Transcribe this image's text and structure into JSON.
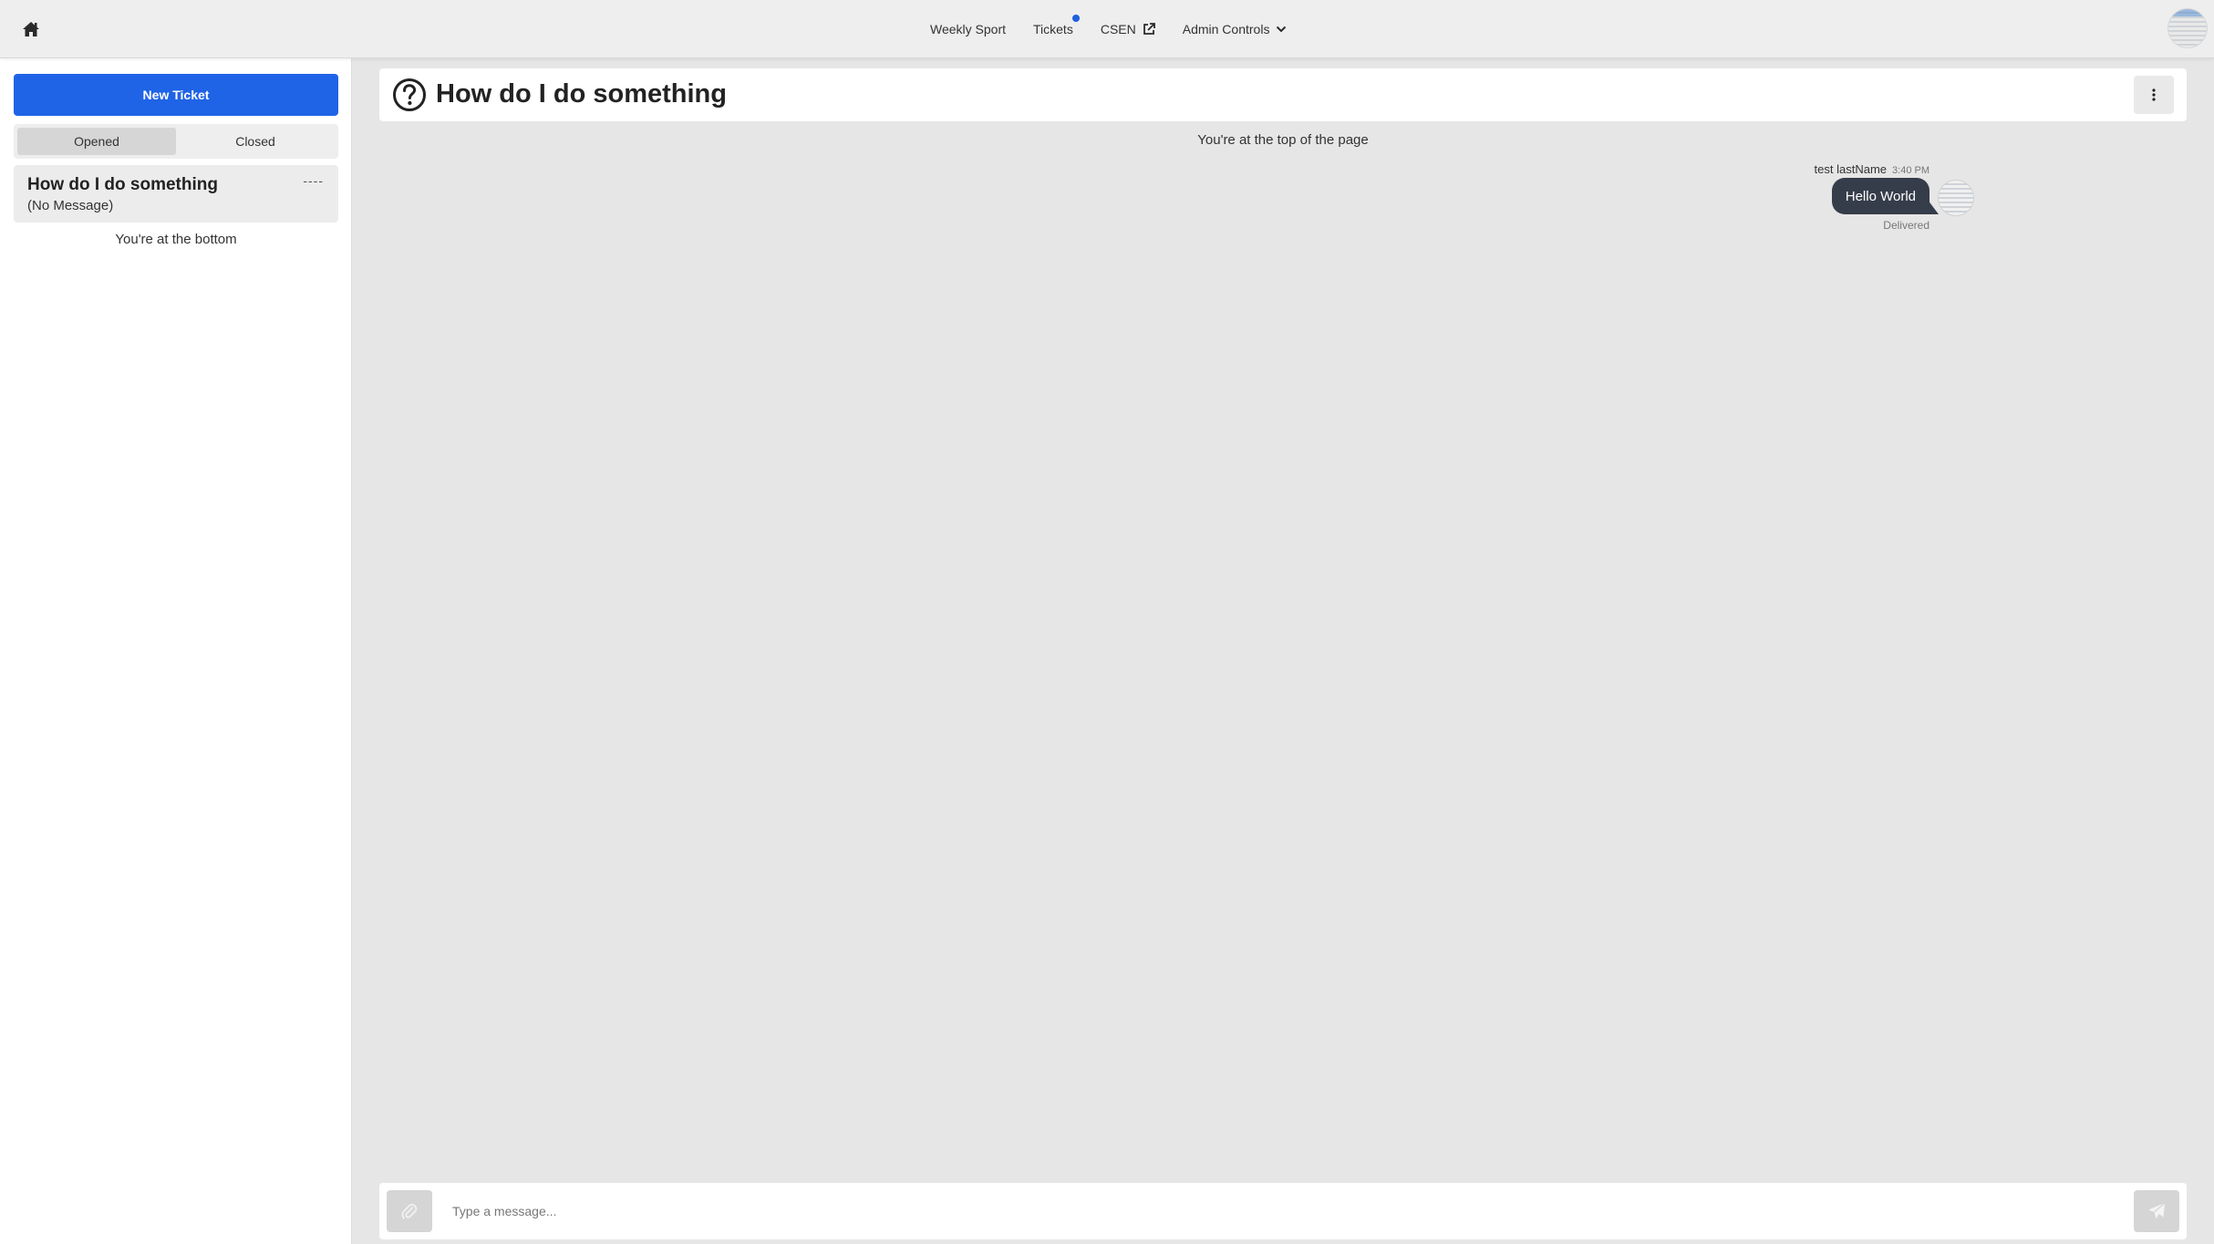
{
  "navbar": {
    "home_icon": "home-icon",
    "items": [
      {
        "label": "Weekly Sport"
      },
      {
        "label": "Tickets",
        "has_notification_dot": true
      },
      {
        "label": "CSEN",
        "icon": "external-link-icon"
      },
      {
        "label": "Admin Controls",
        "icon": "chevron-down-icon"
      }
    ],
    "notification_color": "#1f5fe0"
  },
  "sidebar": {
    "new_ticket_label": "New Ticket",
    "filter": {
      "options": [
        "Opened",
        "Closed"
      ],
      "selected": "Opened"
    },
    "tickets": [
      {
        "title": "How do I do something",
        "preview": "(No Message)",
        "time": "----"
      }
    ],
    "bottom_note": "You're at the bottom"
  },
  "chat": {
    "title": "How do I do something",
    "top_note": "You're at the top of the page",
    "messages": [
      {
        "sender": "test lastName",
        "time": "3:40 PM",
        "text": "Hello World",
        "status": "Delivered"
      }
    ],
    "composer": {
      "placeholder": "Type a message..."
    }
  },
  "colors": {
    "accent": "#1f63e6",
    "bubble": "#363d4a"
  }
}
